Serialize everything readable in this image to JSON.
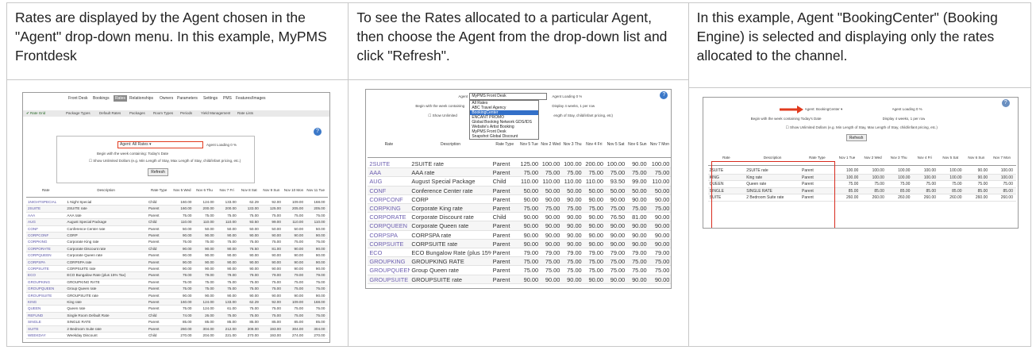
{
  "columns": [
    {
      "text": "Rates are displayed by the Agent chosen in the \"Agent\" drop-down menu. In this example, MyPMS Frontdesk",
      "screenshot": {
        "nav_tabs": [
          "Front Desk",
          "Bookings",
          "Rates",
          "Relationships",
          "Owners",
          "Parameters",
          "Settings",
          "PMS",
          "Features/Images"
        ],
        "active_tab": "Rates",
        "sub_tabs": [
          "Rate Grid",
          "Package Types",
          "Default Rates",
          "Packages",
          "Room Types",
          "Periods",
          "Yield Management",
          "Rate Lists"
        ],
        "agent_label": "Agent",
        "agent_value": "All Rates",
        "agent_loading": "Agent Loading 0 %",
        "begin_text": "Begin with the week containing: Today's Date",
        "show_text": "Show Unlimited Dollars (e.g. Min Length of Stay, Max Length of Stay, child/infant pricing, etc.)",
        "refresh_label": "Refresh",
        "headers": [
          "Rate",
          "Description",
          "Rate Type",
          "Nov 5 Wed",
          "Nov 6 Thu",
          "Nov 7 Fri",
          "Nov 8 Sat",
          "Nov 9 Sun",
          "Nov 10 Mon",
          "Nov 11 Tue"
        ],
        "rows": [
          [
            "1NIGHTSPECIAL",
            "1 Night Special",
            "Child",
            "160.00",
            "124.00",
            "133.00",
            "62.29",
            "92.00",
            "109.00",
            "168.00"
          ],
          [
            "2SUITE",
            "2SUITE rate",
            "Parent",
            "160.00",
            "200.00",
            "200.00",
            "133.00",
            "125.00",
            "205.00",
            "205.00"
          ],
          [
            "AAA",
            "AAA rate",
            "Parent",
            "75.00",
            "75.00",
            "75.00",
            "75.00",
            "75.00",
            "75.00",
            "75.00"
          ],
          [
            "AUG",
            "August Special Package",
            "Child",
            "110.00",
            "110.00",
            "110.00",
            "93.50",
            "99.00",
            "110.00",
            "110.00"
          ],
          [
            "CONF",
            "Conference Center rate",
            "Parent",
            "50.00",
            "50.00",
            "50.00",
            "50.00",
            "50.00",
            "50.00",
            "50.00"
          ],
          [
            "CORPCONF",
            "CORP",
            "Parent",
            "90.00",
            "90.00",
            "90.00",
            "90.00",
            "90.00",
            "90.00",
            "90.00"
          ],
          [
            "CORPKING",
            "Corporate King rate",
            "Parent",
            "75.00",
            "75.00",
            "75.00",
            "75.00",
            "75.00",
            "75.00",
            "75.00"
          ],
          [
            "CORPORATE",
            "Corporate Discount rate",
            "Child",
            "90.00",
            "90.00",
            "90.00",
            "76.50",
            "81.00",
            "90.00",
            "90.00"
          ],
          [
            "CORPQUEEN",
            "Corporate Queen rate",
            "Parent",
            "90.00",
            "90.00",
            "90.00",
            "90.00",
            "90.00",
            "90.00",
            "90.00"
          ],
          [
            "CORPSPA",
            "CORPSPA rate",
            "Parent",
            "90.00",
            "90.00",
            "90.00",
            "90.00",
            "90.00",
            "90.00",
            "90.00"
          ],
          [
            "CORPSUITE",
            "CORPSUITE rate",
            "Parent",
            "90.00",
            "90.00",
            "90.00",
            "90.00",
            "90.00",
            "90.00",
            "90.00"
          ],
          [
            "ECO",
            "ECO Bungalow Rate (plus 15% Tax)",
            "Parent",
            "79.00",
            "79.00",
            "79.00",
            "79.00",
            "79.00",
            "79.00",
            "79.00"
          ],
          [
            "GROUPKING",
            "GROUPKING RATE",
            "Parent",
            "75.00",
            "75.00",
            "75.00",
            "75.00",
            "75.00",
            "75.00",
            "75.00"
          ],
          [
            "GROUPQUEEN",
            "Group Queen rate",
            "Parent",
            "75.00",
            "75.00",
            "75.00",
            "75.00",
            "75.00",
            "75.00",
            "75.00"
          ],
          [
            "GROUPSUITE",
            "GROUPSUITE rate",
            "Parent",
            "90.00",
            "90.00",
            "90.00",
            "90.00",
            "90.00",
            "90.00",
            "90.00"
          ],
          [
            "KING",
            "King rate",
            "Parent",
            "160.00",
            "124.00",
            "133.00",
            "62.29",
            "92.00",
            "109.00",
            "168.00"
          ],
          [
            "QUEEN",
            "Queen rate",
            "Parent",
            "75.00",
            "124.00",
            "61.00",
            "75.00",
            "75.00",
            "75.00",
            "75.00"
          ],
          [
            "REFUND",
            "Single Room Default Rate",
            "Child",
            "74.00",
            "26.00",
            "75.00",
            "75.00",
            "75.00",
            "75.00",
            "75.00"
          ],
          [
            "SINGLE",
            "SINGLE RATE",
            "Parent",
            "85.00",
            "85.00",
            "85.00",
            "85.00",
            "85.00",
            "85.00",
            "85.00"
          ],
          [
            "SUITE",
            "2 Bedroom Suite rate",
            "Parent",
            "260.00",
            "304.00",
            "212.00",
            "208.00",
            "193.00",
            "304.00",
            "304.00"
          ],
          [
            "WEEKDAY",
            "Weekday Discount",
            "Child",
            "270.00",
            "204.00",
            "221.00",
            "270.00",
            "193.00",
            "274.00",
            "270.00"
          ]
        ]
      }
    },
    {
      "text": "To see the Rates allocated to a particular Agent, then choose the Agent from the drop-down list and click \"Refresh\".",
      "screenshot": {
        "agent_label": "Agent",
        "agent_value": "MyPMS Front Desk",
        "agent_loading": "Agent Loading 0 %",
        "begin_text": "Begin with the week containing",
        "display_text": "Display 4 weeks, 1 per row",
        "show_text": "Show Unlimited",
        "show_tail": "ength of Stay, child/infant pricing, etc)",
        "dropdown_items": [
          "All Rates",
          "ABC Travel Agency",
          "BookingCenter",
          "ENCANT PROMO",
          "Global Booking Network GDS/IDS",
          "Website's Artist Booking",
          "MyPMS Front Desk",
          "Snapshot Global Discount"
        ],
        "dropdown_selected": "BookingCenter",
        "headers": [
          "Rate",
          "Description",
          "Rate Type",
          "Nov 5 Tue",
          "Nov 2 Wed",
          "Nov 3 Thu",
          "Nov 4 Fri",
          "Nov 5 Sat",
          "Nov 6 Sun",
          "Nov 7 Mon"
        ],
        "rows": [
          [
            "2SUITE",
            "2SUITE rate",
            "Parent",
            "125.00",
            "100.00",
            "100.00",
            "200.00",
            "100.00",
            "90.00",
            "100.00"
          ],
          [
            "AAA",
            "AAA rate",
            "Parent",
            "75.00",
            "75.00",
            "75.00",
            "75.00",
            "75.00",
            "75.00",
            "75.00"
          ],
          [
            "AUG",
            "August Special Package",
            "Child",
            "110.00",
            "110.00",
            "110.00",
            "110.00",
            "93.50",
            "99.00",
            "110.00"
          ],
          [
            "CONF",
            "Conference Center rate",
            "Parent",
            "50.00",
            "50.00",
            "50.00",
            "50.00",
            "50.00",
            "50.00",
            "50.00"
          ],
          [
            "CORPCONF",
            "CORP",
            "Parent",
            "90.00",
            "90.00",
            "90.00",
            "90.00",
            "90.00",
            "90.00",
            "90.00"
          ],
          [
            "CORPKING",
            "Corporate King rate",
            "Parent",
            "75.00",
            "75.00",
            "75.00",
            "75.00",
            "75.00",
            "75.00",
            "75.00"
          ],
          [
            "CORPORATE",
            "Corporate Discount rate",
            "Child",
            "90.00",
            "90.00",
            "90.00",
            "90.00",
            "76.50",
            "81.00",
            "90.00"
          ],
          [
            "CORPQUEEN",
            "Corporate Queen rate",
            "Parent",
            "90.00",
            "90.00",
            "90.00",
            "90.00",
            "90.00",
            "90.00",
            "90.00"
          ],
          [
            "CORPSPA",
            "CORPSPA rate",
            "Parent",
            "90.00",
            "90.00",
            "90.00",
            "90.00",
            "90.00",
            "90.00",
            "90.00"
          ],
          [
            "CORPSUITE",
            "CORPSUITE rate",
            "Parent",
            "90.00",
            "90.00",
            "90.00",
            "90.00",
            "90.00",
            "90.00",
            "90.00"
          ],
          [
            "ECO",
            "ECO Bungalow Rate (plus 15% Tax)",
            "Parent",
            "79.00",
            "79.00",
            "79.00",
            "79.00",
            "79.00",
            "79.00",
            "79.00"
          ],
          [
            "GROUPKING",
            "GROUPKING RATE",
            "Parent",
            "75.00",
            "75.00",
            "75.00",
            "75.00",
            "75.00",
            "75.00",
            "75.00"
          ],
          [
            "GROUPQUEEN",
            "Group Queen rate",
            "Parent",
            "75.00",
            "75.00",
            "75.00",
            "75.00",
            "75.00",
            "75.00",
            "75.00"
          ],
          [
            "GROUPSUITE",
            "GROUPSUITE rate",
            "Parent",
            "90.00",
            "90.00",
            "90.00",
            "90.00",
            "90.00",
            "90.00",
            "90.00"
          ]
        ]
      }
    },
    {
      "text": "In this example, Agent \"BookingCenter\" (Booking Engine) is selected and displaying only the rates allocated to the channel.",
      "screenshot": {
        "agent_label": "Agent",
        "agent_value": "BookingCenter",
        "agent_loading": "Agent Loading 0 %",
        "begin_text": "Begin with the week containing Today's Date",
        "display_text": "Display 4 weeks, 1 per row",
        "show_text": "Show Unlimited Dollars (e.g. Min Length of Stay, Max Length of Stay, child/infant pricing, etc.)",
        "refresh_label": "Refresh",
        "headers": [
          "Rate",
          "Description",
          "Rate Type",
          "Nov 1 Tue",
          "Nov 2 Wed",
          "Nov 3 Thu",
          "Nov 4 Fri",
          "Nov 5 Sat",
          "Nov 6 Sun",
          "Nov 7 Mon"
        ],
        "rows": [
          [
            "2SUITE",
            "2SUITE rate",
            "Parent",
            "100.00",
            "100.00",
            "100.00",
            "100.00",
            "100.00",
            "90.00",
            "100.00"
          ],
          [
            "KING",
            "King rate",
            "Parent",
            "100.00",
            "100.00",
            "100.00",
            "100.00",
            "100.00",
            "90.00",
            "100.00"
          ],
          [
            "QUEEN",
            "Queen rate",
            "Parent",
            "75.00",
            "75.00",
            "75.00",
            "75.00",
            "75.00",
            "75.00",
            "75.00"
          ],
          [
            "SINGLE",
            "SINGLE RATE",
            "Parent",
            "85.00",
            "85.00",
            "85.00",
            "85.00",
            "85.00",
            "85.00",
            "85.00"
          ],
          [
            "SUITE",
            "2 Bedroom Suite rate",
            "Parent",
            "260.00",
            "260.00",
            "260.00",
            "260.00",
            "260.00",
            "260.00",
            "260.00"
          ]
        ]
      }
    }
  ]
}
